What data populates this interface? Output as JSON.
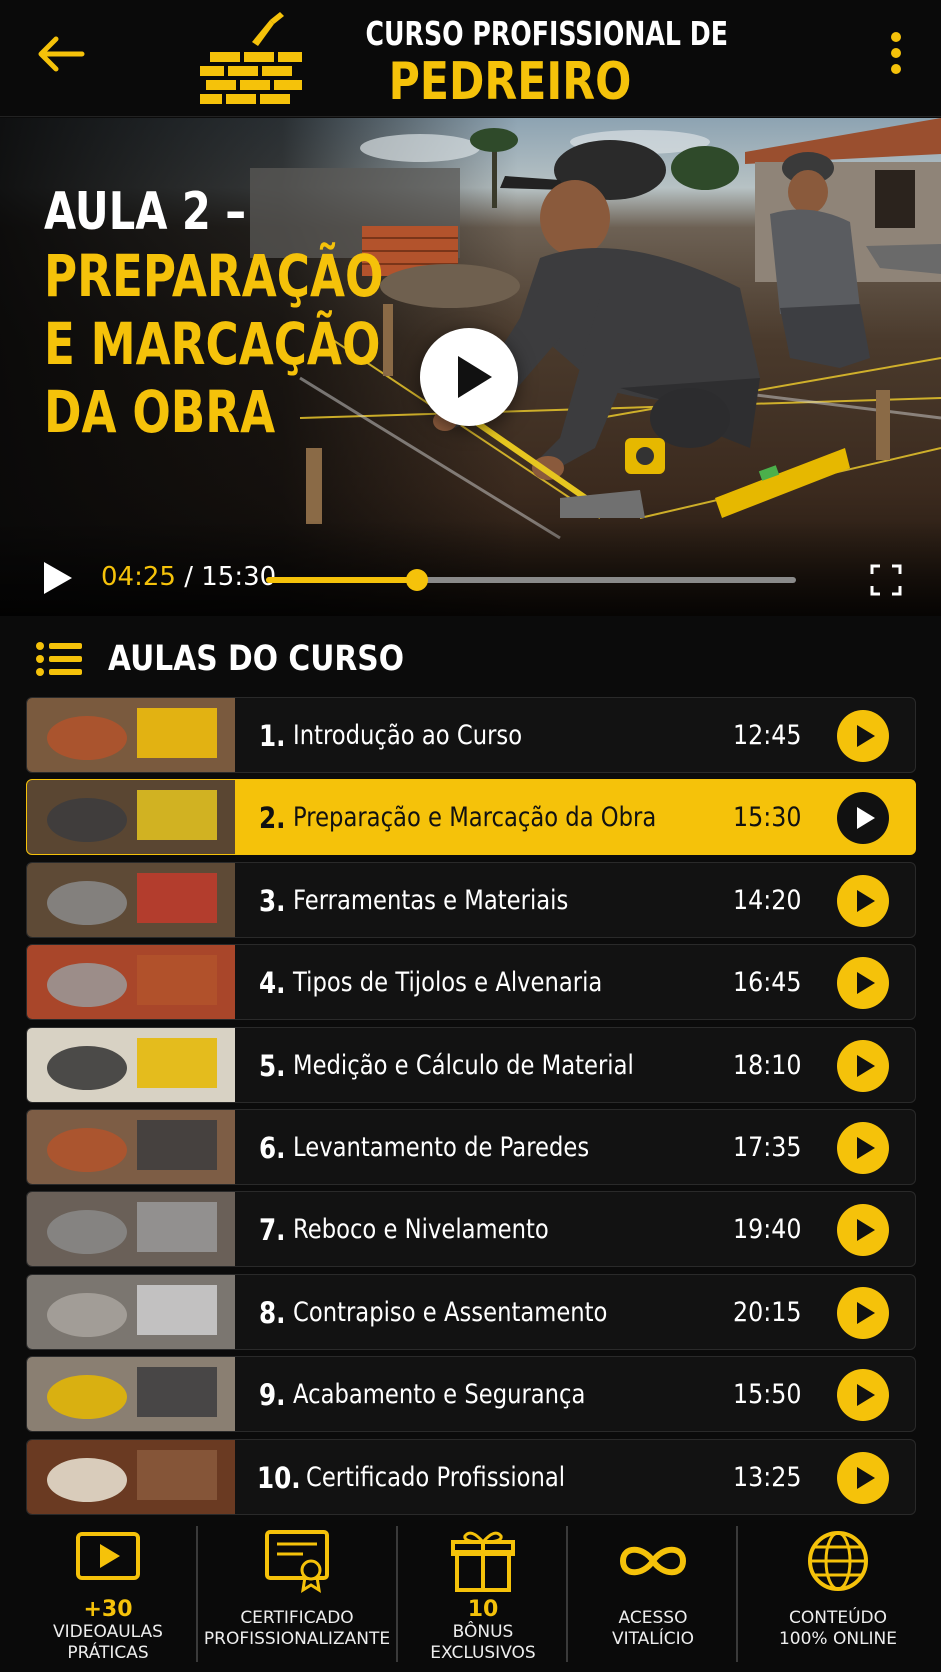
{
  "header": {
    "title_line1": "CURSO PROFISSIONAL DE",
    "title_line2": "PEDREIRO",
    "back_icon": "arrow-left-icon",
    "menu_icon": "kebab-menu-icon",
    "logo_icon": "trowel-bricks-logo"
  },
  "video": {
    "lesson_prefix": "AULA 2 –",
    "lesson_title_lines": [
      "PREPARAÇÃO",
      "E MARCAÇÃO",
      "DA OBRA"
    ],
    "current_time": "04:25",
    "separator": "/",
    "total_time": "15:30",
    "progress": 0.285
  },
  "lessons_header": {
    "title": "AULAS DO CURSO",
    "icon": "list-icon"
  },
  "lessons": [
    {
      "num": "1.",
      "title": "Introdução ao Curso",
      "duration": "12:45"
    },
    {
      "num": "2.",
      "title": "Preparação e Marcação da Obra",
      "duration": "15:30",
      "active": true
    },
    {
      "num": "3.",
      "title": "Ferramentas e Materiais",
      "duration": "14:20"
    },
    {
      "num": "4.",
      "title": "Tipos de Tijolos e Alvenaria",
      "duration": "16:45"
    },
    {
      "num": "5.",
      "title": "Medição e Cálculo de Material",
      "duration": "18:10"
    },
    {
      "num": "6.",
      "title": "Levantamento de Paredes",
      "duration": "17:35"
    },
    {
      "num": "7.",
      "title": "Reboco e Nivelamento",
      "duration": "19:40"
    },
    {
      "num": "8.",
      "title": "Contrapiso e Assentamento",
      "duration": "20:15"
    },
    {
      "num": "9.",
      "title": "Acabamento e Segurança",
      "duration": "15:50"
    },
    {
      "num": "10.",
      "title": "Certificado Profissional",
      "duration": "13:25"
    }
  ],
  "features": [
    {
      "icon": "video-play-icon",
      "highlight": "+30",
      "lines": [
        "VIDEOAULAS",
        "PRÁTICAS"
      ]
    },
    {
      "icon": "certificate-icon",
      "highlight": "",
      "lines": [
        "CERTIFICADO",
        "PROFISSIONALIZANTE"
      ]
    },
    {
      "icon": "gift-icon",
      "highlight": "10",
      "lines": [
        "BÔNUS",
        "EXCLUSIVOS"
      ]
    },
    {
      "icon": "infinity-icon",
      "highlight": "",
      "lines": [
        "ACESSO",
        "VITALÍCIO"
      ]
    },
    {
      "icon": "globe-icon",
      "highlight": "",
      "lines": [
        "CONTEÚDO",
        "100% ONLINE"
      ]
    }
  ],
  "colors": {
    "accent": "#f5c20a",
    "background": "#0b0b0b"
  }
}
